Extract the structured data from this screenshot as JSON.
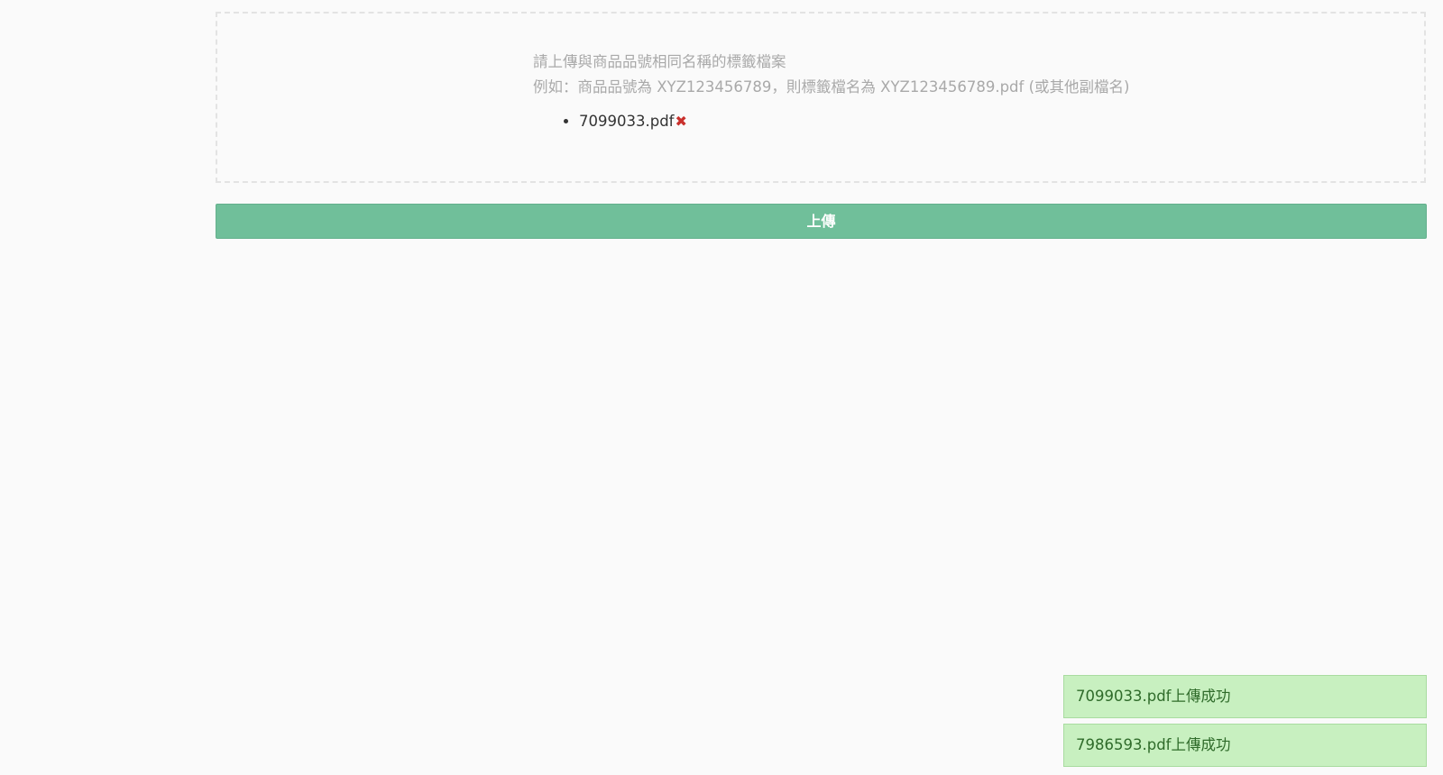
{
  "dropzone": {
    "hint_line1": "請上傳與商品品號相同名稱的標籤檔案",
    "hint_line2": "例如：商品品號為 XYZ123456789，則標籤檔名為 XYZ123456789.pdf (或其他副檔名)",
    "files": [
      {
        "name": "7099033.pdf",
        "remove_icon": "✖"
      }
    ]
  },
  "upload_button": {
    "label": "上傳"
  },
  "toasts": [
    {
      "message": "7099033.pdf上傳成功"
    },
    {
      "message": "7986593.pdf上傳成功"
    }
  ],
  "colors": {
    "button_bg": "#70bf9a",
    "toast_bg": "#c8f0c0",
    "remove_icon": "#c9302c",
    "hint_text": "#a9a9a9"
  }
}
